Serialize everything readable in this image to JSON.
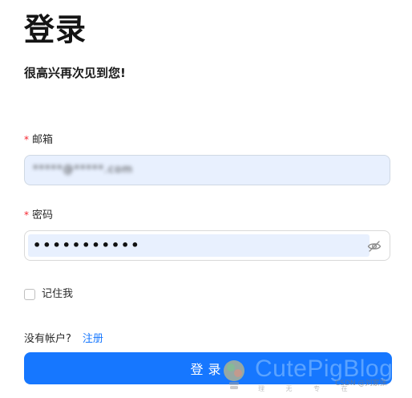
{
  "page": {
    "title": "登录",
    "subtitle": "很高兴再次见到您!"
  },
  "form": {
    "email": {
      "required_mark": "*",
      "label": "邮箱",
      "value": "*****@*****.com"
    },
    "password": {
      "required_mark": "*",
      "label": "密码",
      "value": "•••••••••••",
      "toggle_icon": "eye-invisible-icon"
    },
    "remember_me": {
      "label": "记住我",
      "checked": false
    },
    "signup_prompt": "没有帐户?",
    "signup_link": "注册",
    "submit_label": "登录"
  },
  "watermark": {
    "brand": "CutePigBlog",
    "sub": "理 无 专 在",
    "source": "CSDN @刘家张"
  },
  "colors": {
    "primary": "#1677ff",
    "required": "#f5222d",
    "autofill": "#e8f0fe"
  }
}
